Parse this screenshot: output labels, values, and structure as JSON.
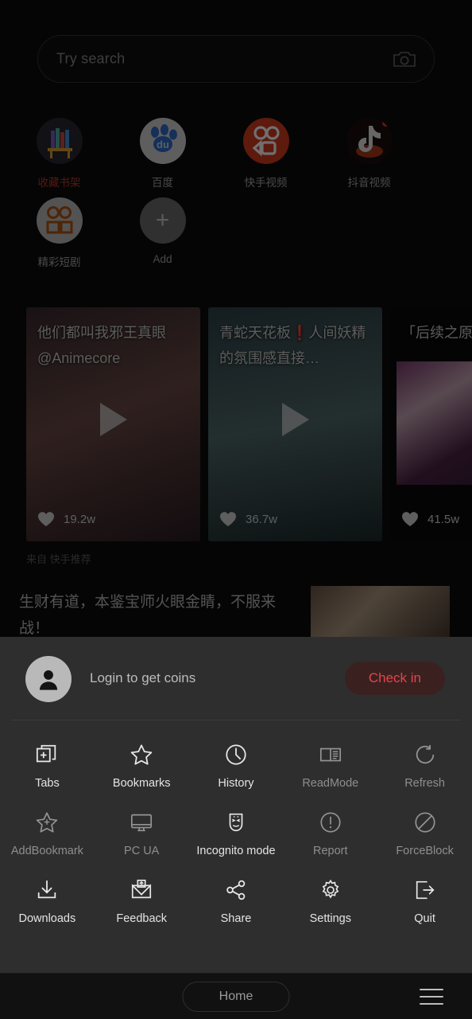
{
  "colors": {
    "page_bg": "#0c0c0c",
    "sheet_bg": "#2e2e2e",
    "accent_red": "#e0474a",
    "hot_label": "#c0392b",
    "badge": "#e8333a"
  },
  "search": {
    "placeholder": "Try search",
    "camera_icon": "camera-icon"
  },
  "shortcuts": [
    {
      "label": "收藏书架",
      "icon": "bookshelf-icon",
      "highlight": true,
      "badge": false
    },
    {
      "label": "百度",
      "icon": "baidu-paw-icon",
      "highlight": false,
      "badge": false
    },
    {
      "label": "快手视频",
      "icon": "kuaishou-icon",
      "highlight": false,
      "badge": false
    },
    {
      "label": "抖音视频",
      "icon": "douyin-icon",
      "highlight": false,
      "badge": true
    },
    {
      "label": "精彩短剧",
      "icon": "duanju-icon",
      "highlight": false,
      "badge": false
    },
    {
      "label": "Add",
      "icon": "plus-icon",
      "highlight": false,
      "badge": false
    }
  ],
  "feed": {
    "source_text": "来自 快手推荐",
    "cards": [
      {
        "title": "他们都叫我邪王真眼  @Animecore",
        "likes": "19.2w",
        "play_icon": "play-icon",
        "like_icon": "heart-icon"
      },
      {
        "title_pre": "青蛇天花板",
        "title_bang": "❗",
        "title_post": "人间妖精的氛围感直接…",
        "likes": "36.7w",
        "play_icon": "play-icon",
        "like_icon": "heart-icon"
      },
      {
        "title": "「后续之原创阁下",
        "likes": "41.5w",
        "play_icon": "play-icon",
        "like_icon": "heart-icon"
      }
    ],
    "news_headline": "生财有道，本鉴宝师火眼金睛，不服来战！"
  },
  "sheet": {
    "login_text": "Login to get coins",
    "avatar_icon": "person-icon",
    "checkin_label": "Check in",
    "rows": [
      [
        {
          "label": "Tabs",
          "icon": "tabs-icon",
          "dim": false
        },
        {
          "label": "Bookmarks",
          "icon": "star-icon",
          "dim": false
        },
        {
          "label": "History",
          "icon": "clock-icon",
          "dim": false
        },
        {
          "label": "ReadMode",
          "icon": "readmode-icon",
          "dim": true
        },
        {
          "label": "Refresh",
          "icon": "refresh-icon",
          "dim": true
        }
      ],
      [
        {
          "label": "AddBookmark",
          "icon": "star-plus-icon",
          "dim": true
        },
        {
          "label": "PC UA",
          "icon": "monitor-icon",
          "dim": true
        },
        {
          "label": "Incognito mode",
          "icon": "mask-icon",
          "dim": false
        },
        {
          "label": "Report",
          "icon": "warning-icon",
          "dim": true
        },
        {
          "label": "ForceBlock",
          "icon": "block-icon",
          "dim": true
        }
      ],
      [
        {
          "label": "Downloads",
          "icon": "download-icon",
          "dim": false
        },
        {
          "label": "Feedback",
          "icon": "envelope-icon",
          "dim": false
        },
        {
          "label": "Share",
          "icon": "share-icon",
          "dim": false
        },
        {
          "label": "Settings",
          "icon": "gear-icon",
          "dim": false
        },
        {
          "label": "Quit",
          "icon": "exit-icon",
          "dim": false
        }
      ]
    ]
  },
  "navbar": {
    "home_label": "Home",
    "menu_icon": "hamburger-icon"
  }
}
